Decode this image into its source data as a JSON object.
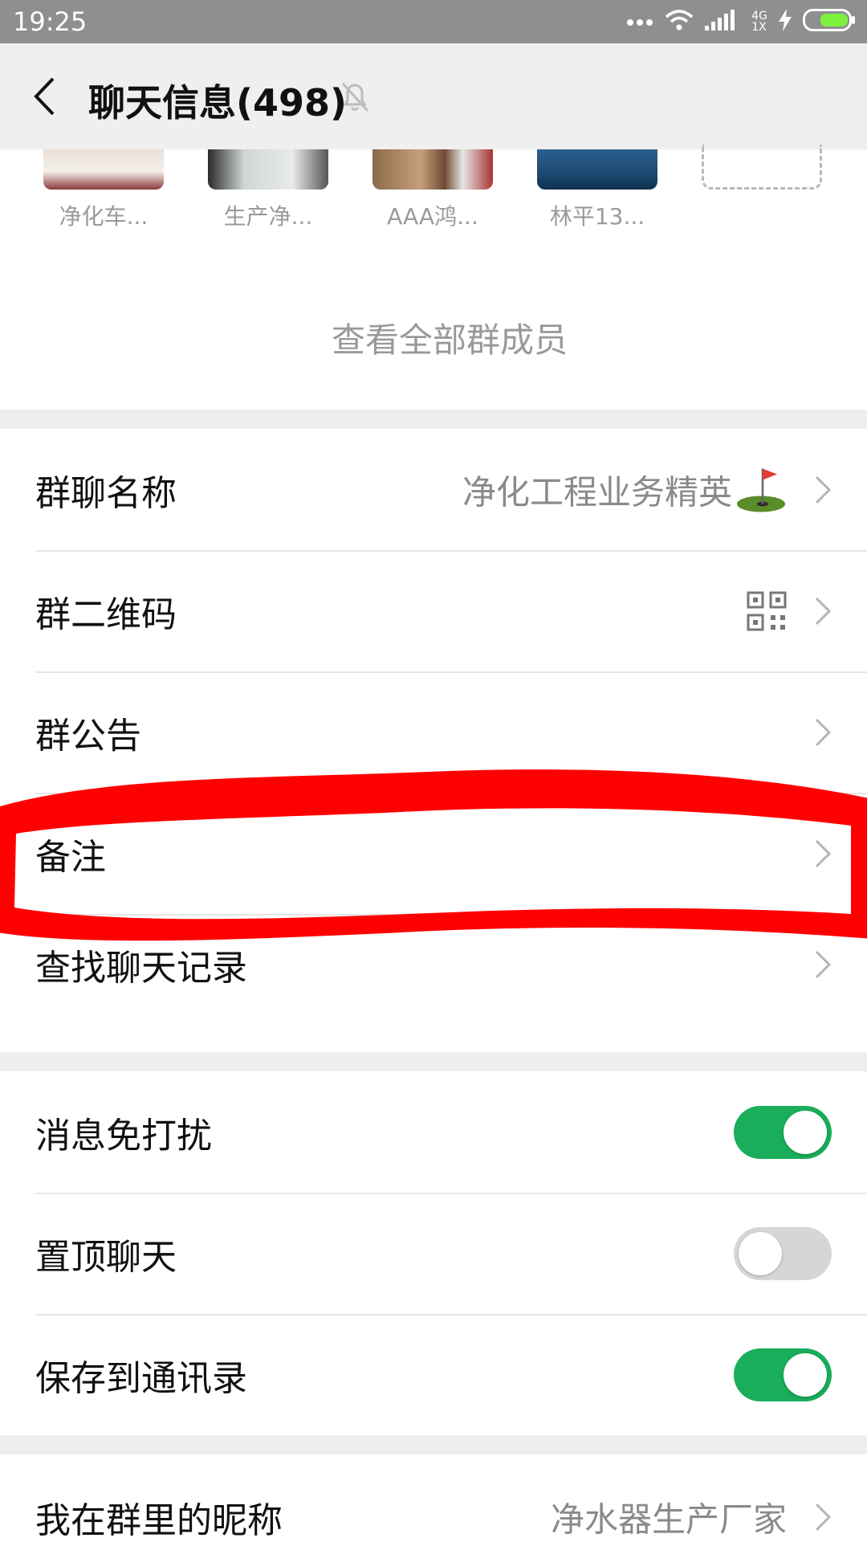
{
  "status_bar": {
    "time": "19:25",
    "network": "4G\n1X"
  },
  "nav": {
    "title": "聊天信息(498)"
  },
  "members": [
    {
      "name": "净化车..."
    },
    {
      "name": "生产净..."
    },
    {
      "name": "AAA鸿..."
    },
    {
      "name": "林平13..."
    }
  ],
  "view_all_label": "查看全部群成员",
  "group_section": {
    "name_label": "群聊名称",
    "name_value": "净化工程业务精英",
    "qr_label": "群二维码",
    "notice_label": "群公告",
    "remark_label": "备注",
    "search_label": "查找聊天记录"
  },
  "settings_section": {
    "mute_label": "消息免打扰",
    "mute_on": true,
    "pin_label": "置顶聊天",
    "pin_on": false,
    "save_label": "保存到通讯录",
    "save_on": true
  },
  "nickname_section": {
    "label": "我在群里的昵称",
    "value": "净水器生产厂家"
  },
  "colors": {
    "accent_green": "#1aad5a",
    "annotation_red": "#ff0000"
  }
}
